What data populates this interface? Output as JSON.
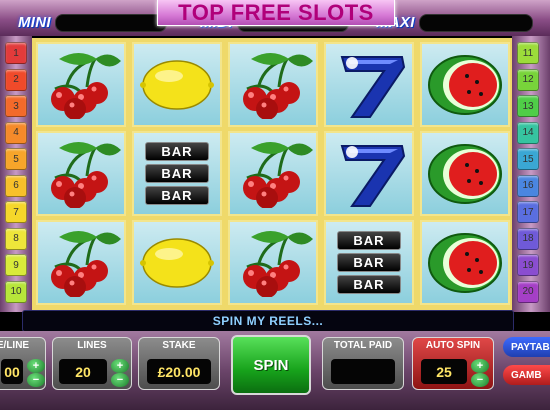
{
  "banner": {
    "title": "TOP FREE SLOTS"
  },
  "jackpots": {
    "mini": "MINI",
    "midi": "MIDI",
    "maxi": "MAXI"
  },
  "paylines": {
    "left": [
      "1",
      "2",
      "3",
      "4",
      "5",
      "6",
      "7",
      "8",
      "9",
      "10"
    ],
    "right": [
      "11",
      "12",
      "13",
      "14",
      "15",
      "16",
      "17",
      "18",
      "19",
      "20"
    ],
    "colors": [
      "#e23b3b",
      "#f04a2a",
      "#f36a2a",
      "#f58a2a",
      "#f7a52a",
      "#f7c02a",
      "#f5d72a",
      "#eee63a",
      "#d9ea3a",
      "#b7e63a",
      "#9cdc3a",
      "#78d43a",
      "#4fcd47",
      "#36c4a0",
      "#3aa7d4",
      "#4a86e0",
      "#5a6ee0",
      "#6f5ad8",
      "#8a4dd0",
      "#a53fc6"
    ]
  },
  "reels": [
    [
      "cherry",
      "cherry",
      "cherry"
    ],
    [
      "lemon",
      "bar",
      "lemon"
    ],
    [
      "cherry",
      "cherry",
      "cherry"
    ],
    [
      "seven",
      "seven",
      "bar"
    ],
    [
      "melon",
      "melon",
      "melon"
    ]
  ],
  "symbols": {
    "bar_text": "BAR"
  },
  "message": "SPIN MY REELS...",
  "controls": {
    "bet_per_line": {
      "label": "E/LINE",
      "value": "00"
    },
    "lines": {
      "label": "LINES",
      "value": "20"
    },
    "stake": {
      "label": "STAKE",
      "value": "£20.00"
    },
    "spin": {
      "label": "SPIN"
    },
    "total_paid": {
      "label": "TOTAL PAID",
      "value": ""
    },
    "auto_spin": {
      "label": "AUTO SPIN",
      "value": "25"
    },
    "paytable": {
      "label": "PAYTAB"
    },
    "gamble": {
      "label": "GAMB"
    },
    "plus": "+",
    "minus": "−"
  },
  "colors": {
    "reel_frame": "#efd96a",
    "message_text": "#8fd0ff",
    "value_text": "#ffe566",
    "spin": "#17a21b"
  }
}
